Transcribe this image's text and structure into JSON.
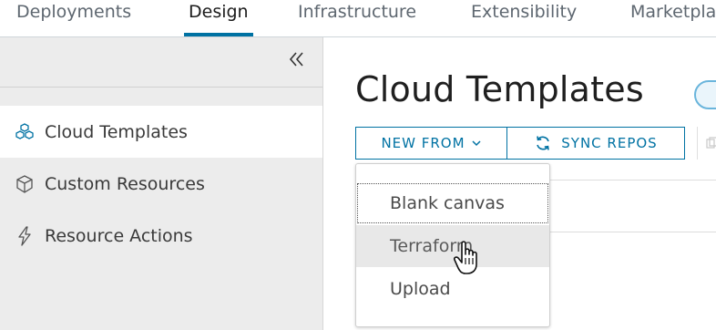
{
  "nav": {
    "tabs": [
      {
        "label": "Deployments"
      },
      {
        "label": "Design"
      },
      {
        "label": "Infrastructure"
      },
      {
        "label": "Extensibility"
      },
      {
        "label": "Marketpla"
      }
    ],
    "active_tab": "Design"
  },
  "sidebar": {
    "items": [
      {
        "label": "Cloud Templates",
        "icon": "cloud-templates-icon",
        "active": true
      },
      {
        "label": "Custom Resources",
        "icon": "cube-icon",
        "active": false
      },
      {
        "label": "Resource Actions",
        "icon": "lightning-icon",
        "active": false
      }
    ]
  },
  "main": {
    "title": "Cloud Templates",
    "new_from_label": "NEW FROM",
    "sync_label": "SYNC REPOS"
  },
  "dropdown": {
    "items": [
      {
        "label": "Blank canvas"
      },
      {
        "label": "Terraform"
      },
      {
        "label": "Upload"
      }
    ],
    "hovered": "Terraform"
  },
  "colors": {
    "accent": "#0072a3",
    "sidebar_bg": "#ececec"
  }
}
